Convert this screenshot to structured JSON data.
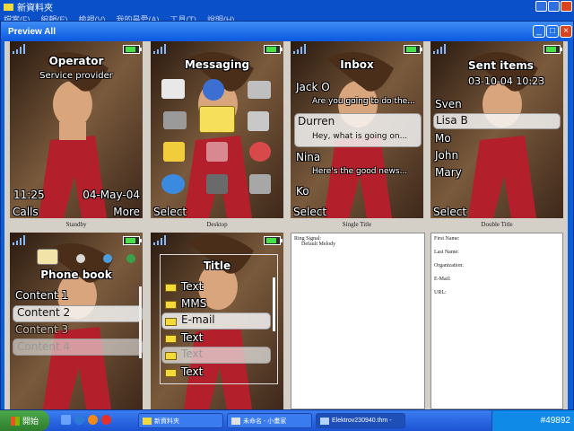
{
  "background_window": {
    "title": "新資料夾",
    "menu": [
      "檔案(F)",
      "編輯(E)",
      "檢視(V)",
      "我的最愛(A)",
      "工具(T)",
      "說明(H)"
    ]
  },
  "window": {
    "title": "Preview All"
  },
  "screens": {
    "standby": {
      "operator": "Operator",
      "provider": "Service provider",
      "time": "11:25",
      "date": "04-May-04",
      "left_soft": "Calls",
      "right_soft": "More",
      "label": "Standby"
    },
    "desktop": {
      "title": "Messaging",
      "left_soft": "Select",
      "label": "Desktop"
    },
    "single": {
      "title": "Inbox",
      "items": [
        "Jack O",
        "Are you going to do the...",
        "Durren",
        "Hey, what is going on...",
        "Nina",
        "Here's the good news...",
        "Ko"
      ],
      "left_soft": "Select",
      "label": "Single Title"
    },
    "double": {
      "title": "Sent items",
      "datetime": "03-10-04 10:23",
      "items": [
        "Sven",
        "Lisa B",
        "Mo",
        "John",
        "Mary"
      ],
      "left_soft": "Select",
      "label": "Double Title"
    },
    "phonebook": {
      "title": "Phone book",
      "items": [
        "Content 1",
        "Content 2",
        "Content 3",
        "Content 4"
      ]
    },
    "list": {
      "title": "Title",
      "items": [
        "Text",
        "MMS",
        "E-mail",
        "Text",
        "Text",
        "Text"
      ]
    }
  },
  "ring_panel": {
    "title": "Ring Signal:",
    "value": "Default Melody"
  },
  "contact_panel": {
    "fields": [
      "First Name:",
      "Last Name:",
      "Organization:",
      "E-Mail:",
      "URL:"
    ]
  },
  "taskbar": {
    "start": "開始",
    "buttons": [
      "新資料夾",
      "未命名 - 小畫家",
      "Elektrov230940.thm -"
    ],
    "tray_text": "#49892"
  }
}
